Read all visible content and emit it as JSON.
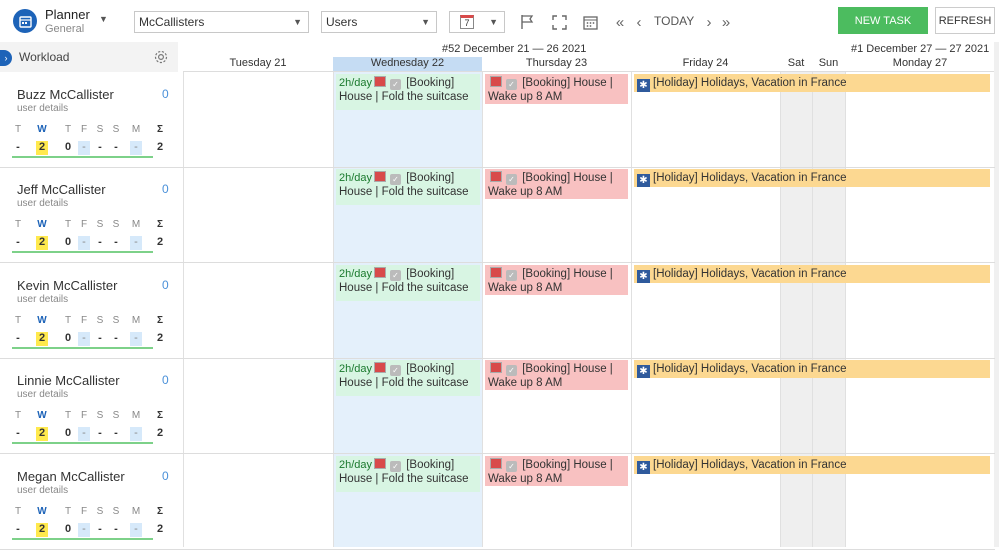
{
  "app": {
    "title": "Planner",
    "subtitle": "General"
  },
  "toolbar": {
    "project_select": "McCallisters",
    "view_select": "Users",
    "calendar_day": "7",
    "today_label": "TODAY",
    "new_task_label": "NEW TASK",
    "refresh_label": "REFRESH"
  },
  "left_panel": {
    "workload_label": "Workload"
  },
  "calendar": {
    "weeks": [
      "#52 December 21 — 26 2021",
      "#1 December 27 — 27 2021"
    ],
    "days": [
      "Tuesday 21",
      "Wednesday 22",
      "Thursday 23",
      "Friday 24",
      "Sat",
      "Sun",
      "Monday 27"
    ]
  },
  "workload_days": [
    "T",
    "W",
    "T",
    "F",
    "S",
    "S",
    "M",
    "Σ"
  ],
  "users": [
    {
      "name": "Buzz McCallister",
      "details": "user details",
      "count": "0",
      "values": [
        "-",
        "2",
        "0",
        "-",
        "-",
        "-",
        "-",
        "2"
      ]
    },
    {
      "name": "Jeff McCallister",
      "details": "user details",
      "count": "0",
      "values": [
        "-",
        "2",
        "0",
        "-",
        "-",
        "-",
        "-",
        "2"
      ]
    },
    {
      "name": "Kevin McCallister",
      "details": "user details",
      "count": "0",
      "values": [
        "-",
        "2",
        "0",
        "-",
        "-",
        "-",
        "-",
        "2"
      ]
    },
    {
      "name": "Linnie McCallister",
      "details": "user details",
      "count": "0",
      "values": [
        "-",
        "2",
        "0",
        "-",
        "-",
        "-",
        "-",
        "2"
      ]
    },
    {
      "name": "Megan McCallister",
      "details": "user details",
      "count": "0",
      "values": [
        "-",
        "2",
        "0",
        "-",
        "-",
        "-",
        "-",
        "2"
      ]
    }
  ],
  "tasks": {
    "wed": {
      "hours": "2h/day",
      "line1": "[Booking]",
      "line2": "House | Fold the suitcase"
    },
    "thu": {
      "line1": "[Booking] House |",
      "line2": "Wake up 8 AM"
    },
    "holiday": {
      "text": "[Holiday] Holidays, Vacation in France"
    }
  },
  "colors": {
    "brand": "#1d63b8",
    "new_task": "#4cbc5f",
    "wednesday_col": "#e4f0fb",
    "booking_wed": "#d8f5e3",
    "booking_thu": "#f8c1c1",
    "holiday": "#fcd891"
  }
}
